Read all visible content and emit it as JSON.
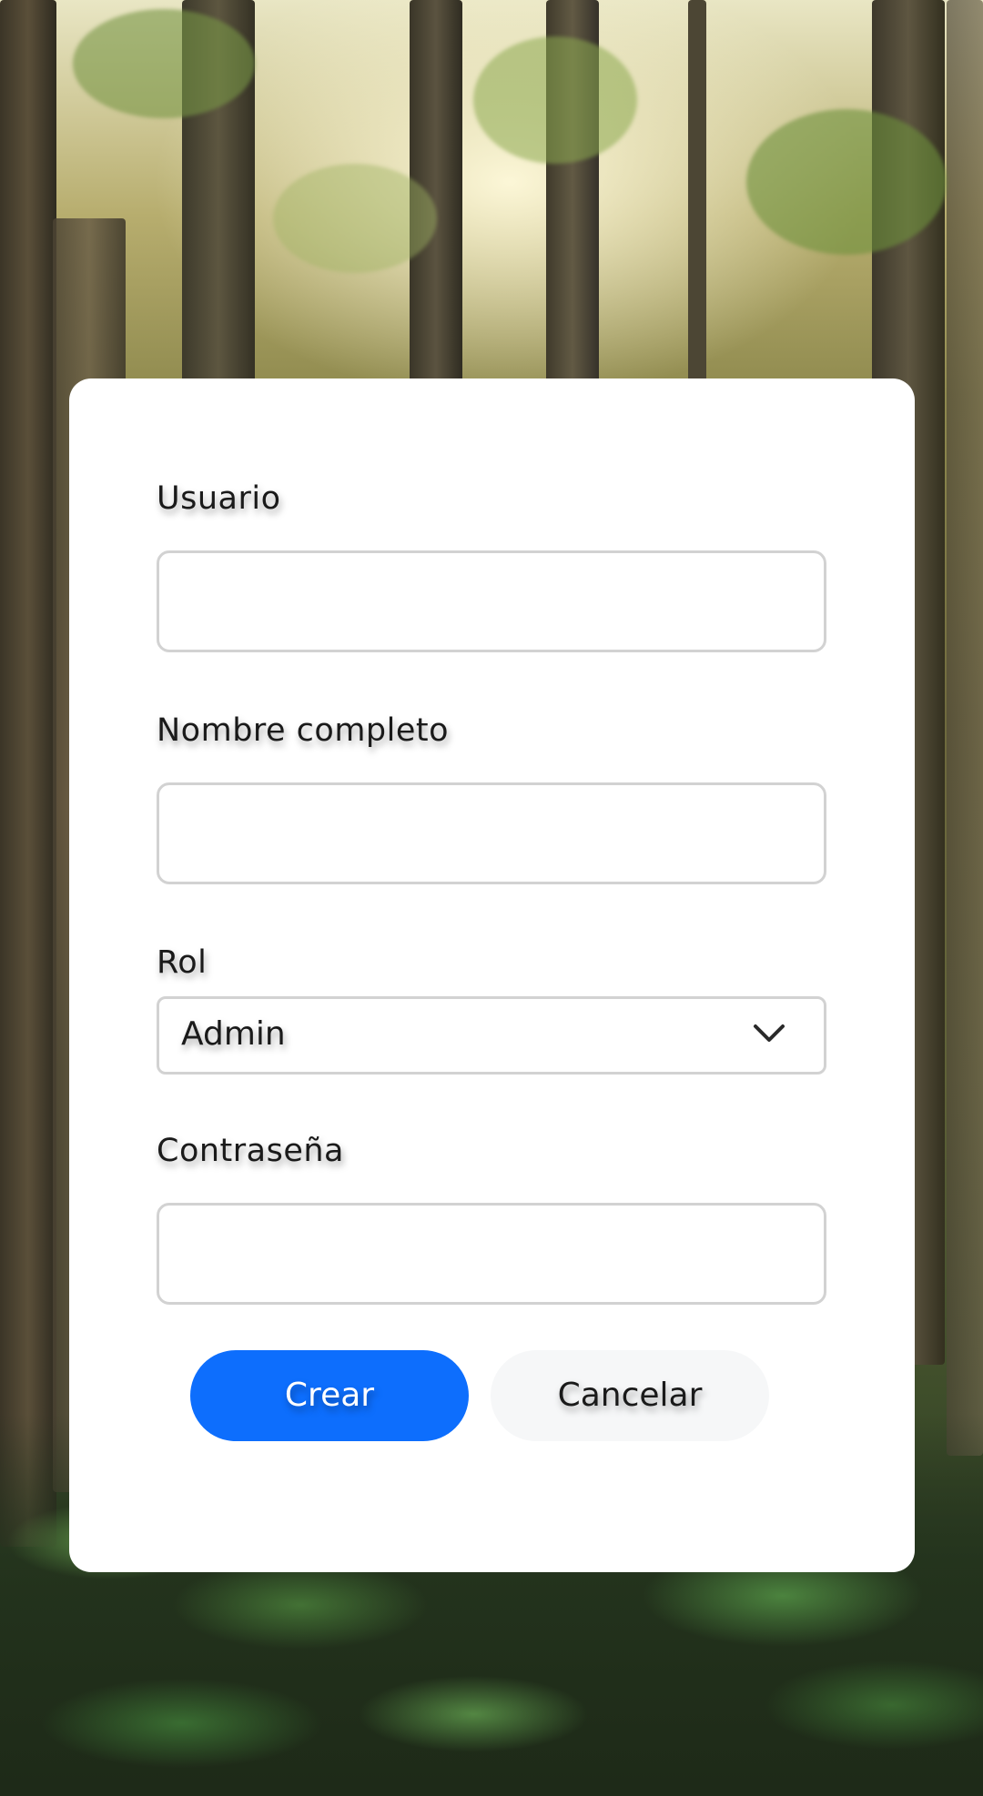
{
  "form": {
    "username": {
      "label": "Usuario",
      "value": "",
      "placeholder": ""
    },
    "full_name": {
      "label": "Nombre completo",
      "value": "",
      "placeholder": ""
    },
    "role": {
      "label": "Rol",
      "selected": "Admin"
    },
    "password": {
      "label": "Contraseña",
      "value": "",
      "placeholder": ""
    }
  },
  "actions": {
    "create_label": "Crear",
    "cancel_label": "Cancelar"
  },
  "icons": {
    "role_dropdown": "chevron-down-icon"
  },
  "colors": {
    "primary": "#0d6efd",
    "secondary_bg": "#f6f7f8",
    "input_border": "#d2d2d2",
    "card_bg": "#ffffff"
  }
}
